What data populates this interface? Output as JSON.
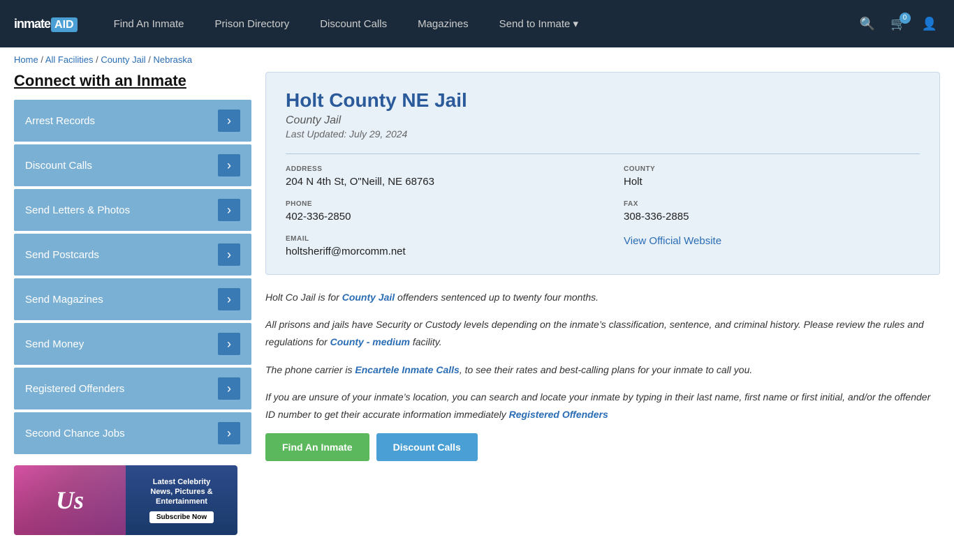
{
  "header": {
    "logo": "inmate",
    "logo_aid": "AID",
    "nav_items": [
      {
        "label": "Find An Inmate",
        "id": "find-an-inmate"
      },
      {
        "label": "Prison Directory",
        "id": "prison-directory"
      },
      {
        "label": "Discount Calls",
        "id": "discount-calls"
      },
      {
        "label": "Magazines",
        "id": "magazines"
      },
      {
        "label": "Send to Inmate ▾",
        "id": "send-to-inmate"
      }
    ],
    "cart_count": "0",
    "search_icon": "🔍",
    "cart_icon": "🛒",
    "user_icon": "👤"
  },
  "breadcrumb": {
    "home": "Home",
    "all_facilities": "All Facilities",
    "county_jail": "County Jail",
    "state": "Nebraska"
  },
  "sidebar": {
    "title": "Connect with an Inmate",
    "menu_items": [
      {
        "label": "Arrest Records",
        "id": "arrest-records"
      },
      {
        "label": "Discount Calls",
        "id": "discount-calls"
      },
      {
        "label": "Send Letters & Photos",
        "id": "send-letters-photos"
      },
      {
        "label": "Send Postcards",
        "id": "send-postcards"
      },
      {
        "label": "Send Magazines",
        "id": "send-magazines"
      },
      {
        "label": "Send Money",
        "id": "send-money"
      },
      {
        "label": "Registered Offenders",
        "id": "registered-offenders"
      },
      {
        "label": "Second Chance Jobs",
        "id": "second-chance-jobs"
      }
    ],
    "ad": {
      "brand": "Us",
      "tagline_1": "Latest Celebrity",
      "tagline_2": "News, Pictures &",
      "tagline_3": "Entertainment",
      "cta": "Subscribe Now"
    }
  },
  "facility": {
    "title": "Holt County NE Jail",
    "type": "County Jail",
    "last_updated": "Last Updated: July 29, 2024",
    "address_label": "ADDRESS",
    "address_value": "204 N 4th St, O\"Neill, NE 68763",
    "county_label": "COUNTY",
    "county_value": "Holt",
    "phone_label": "PHONE",
    "phone_value": "402-336-2850",
    "fax_label": "FAX",
    "fax_value": "308-336-2885",
    "email_label": "EMAIL",
    "email_value": "holtsheriff@morcomm.net",
    "website_label": "View Official Website",
    "website_url": "#"
  },
  "description": {
    "p1_plain": "Holt Co Jail is for ",
    "p1_link": "County Jail",
    "p1_end": " offenders sentenced up to twenty four months.",
    "p2": "All prisons and jails have Security or Custody levels depending on the inmate’s classification, sentence, and criminal history. Please review the rules and regulations for ",
    "p2_link": "County - medium",
    "p2_end": " facility.",
    "p3": "The phone carrier is ",
    "p3_link": "Encartele Inmate Calls",
    "p3_end": ", to see their rates and best-calling plans for your inmate to call you.",
    "p4": "If you are unsure of your inmate’s location, you can search and locate your inmate by typing in their last name, first name or first initial, and/or the offender ID number to get their accurate information immediately ",
    "p4_link": "Registered Offenders",
    "btn1": "Find An Inmate",
    "btn2": "Discount Calls"
  }
}
